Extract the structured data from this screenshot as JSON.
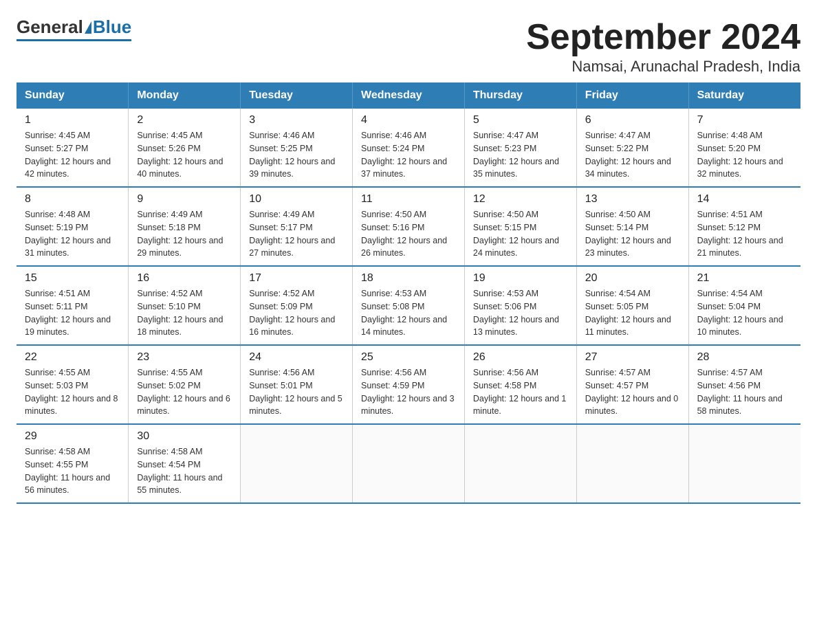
{
  "logo": {
    "general": "General",
    "blue": "Blue"
  },
  "title": "September 2024",
  "subtitle": "Namsai, Arunachal Pradesh, India",
  "days_header": [
    "Sunday",
    "Monday",
    "Tuesday",
    "Wednesday",
    "Thursday",
    "Friday",
    "Saturday"
  ],
  "weeks": [
    [
      {
        "day": "1",
        "sunrise": "4:45 AM",
        "sunset": "5:27 PM",
        "daylight": "12 hours and 42 minutes."
      },
      {
        "day": "2",
        "sunrise": "4:45 AM",
        "sunset": "5:26 PM",
        "daylight": "12 hours and 40 minutes."
      },
      {
        "day": "3",
        "sunrise": "4:46 AM",
        "sunset": "5:25 PM",
        "daylight": "12 hours and 39 minutes."
      },
      {
        "day": "4",
        "sunrise": "4:46 AM",
        "sunset": "5:24 PM",
        "daylight": "12 hours and 37 minutes."
      },
      {
        "day": "5",
        "sunrise": "4:47 AM",
        "sunset": "5:23 PM",
        "daylight": "12 hours and 35 minutes."
      },
      {
        "day": "6",
        "sunrise": "4:47 AM",
        "sunset": "5:22 PM",
        "daylight": "12 hours and 34 minutes."
      },
      {
        "day": "7",
        "sunrise": "4:48 AM",
        "sunset": "5:20 PM",
        "daylight": "12 hours and 32 minutes."
      }
    ],
    [
      {
        "day": "8",
        "sunrise": "4:48 AM",
        "sunset": "5:19 PM",
        "daylight": "12 hours and 31 minutes."
      },
      {
        "day": "9",
        "sunrise": "4:49 AM",
        "sunset": "5:18 PM",
        "daylight": "12 hours and 29 minutes."
      },
      {
        "day": "10",
        "sunrise": "4:49 AM",
        "sunset": "5:17 PM",
        "daylight": "12 hours and 27 minutes."
      },
      {
        "day": "11",
        "sunrise": "4:50 AM",
        "sunset": "5:16 PM",
        "daylight": "12 hours and 26 minutes."
      },
      {
        "day": "12",
        "sunrise": "4:50 AM",
        "sunset": "5:15 PM",
        "daylight": "12 hours and 24 minutes."
      },
      {
        "day": "13",
        "sunrise": "4:50 AM",
        "sunset": "5:14 PM",
        "daylight": "12 hours and 23 minutes."
      },
      {
        "day": "14",
        "sunrise": "4:51 AM",
        "sunset": "5:12 PM",
        "daylight": "12 hours and 21 minutes."
      }
    ],
    [
      {
        "day": "15",
        "sunrise": "4:51 AM",
        "sunset": "5:11 PM",
        "daylight": "12 hours and 19 minutes."
      },
      {
        "day": "16",
        "sunrise": "4:52 AM",
        "sunset": "5:10 PM",
        "daylight": "12 hours and 18 minutes."
      },
      {
        "day": "17",
        "sunrise": "4:52 AM",
        "sunset": "5:09 PM",
        "daylight": "12 hours and 16 minutes."
      },
      {
        "day": "18",
        "sunrise": "4:53 AM",
        "sunset": "5:08 PM",
        "daylight": "12 hours and 14 minutes."
      },
      {
        "day": "19",
        "sunrise": "4:53 AM",
        "sunset": "5:06 PM",
        "daylight": "12 hours and 13 minutes."
      },
      {
        "day": "20",
        "sunrise": "4:54 AM",
        "sunset": "5:05 PM",
        "daylight": "12 hours and 11 minutes."
      },
      {
        "day": "21",
        "sunrise": "4:54 AM",
        "sunset": "5:04 PM",
        "daylight": "12 hours and 10 minutes."
      }
    ],
    [
      {
        "day": "22",
        "sunrise": "4:55 AM",
        "sunset": "5:03 PM",
        "daylight": "12 hours and 8 minutes."
      },
      {
        "day": "23",
        "sunrise": "4:55 AM",
        "sunset": "5:02 PM",
        "daylight": "12 hours and 6 minutes."
      },
      {
        "day": "24",
        "sunrise": "4:56 AM",
        "sunset": "5:01 PM",
        "daylight": "12 hours and 5 minutes."
      },
      {
        "day": "25",
        "sunrise": "4:56 AM",
        "sunset": "4:59 PM",
        "daylight": "12 hours and 3 minutes."
      },
      {
        "day": "26",
        "sunrise": "4:56 AM",
        "sunset": "4:58 PM",
        "daylight": "12 hours and 1 minute."
      },
      {
        "day": "27",
        "sunrise": "4:57 AM",
        "sunset": "4:57 PM",
        "daylight": "12 hours and 0 minutes."
      },
      {
        "day": "28",
        "sunrise": "4:57 AM",
        "sunset": "4:56 PM",
        "daylight": "11 hours and 58 minutes."
      }
    ],
    [
      {
        "day": "29",
        "sunrise": "4:58 AM",
        "sunset": "4:55 PM",
        "daylight": "11 hours and 56 minutes."
      },
      {
        "day": "30",
        "sunrise": "4:58 AM",
        "sunset": "4:54 PM",
        "daylight": "11 hours and 55 minutes."
      },
      null,
      null,
      null,
      null,
      null
    ]
  ],
  "labels": {
    "sunrise": "Sunrise:",
    "sunset": "Sunset:",
    "daylight": "Daylight:"
  }
}
